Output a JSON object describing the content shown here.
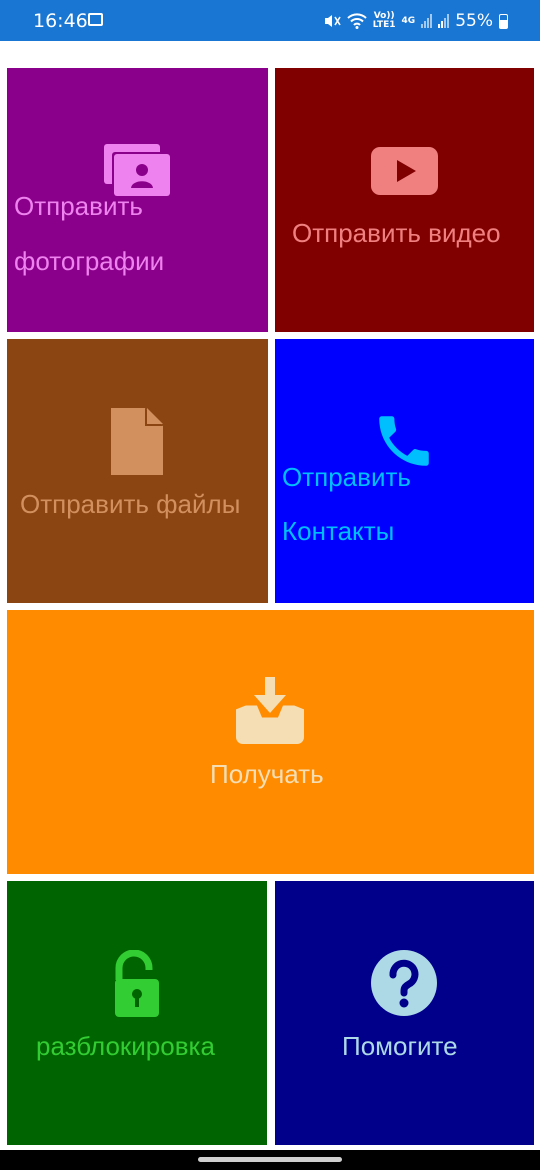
{
  "status_bar": {
    "time": "16:46",
    "network_top": "Vo))",
    "network_bottom": "LTE1",
    "gen": "4G",
    "battery": "55%"
  },
  "tiles": {
    "send_photos": {
      "line1": "Отправить",
      "line2": "фотографии",
      "icon": "photos-icon",
      "color": "#8B008B",
      "text_color": "#EE82EE"
    },
    "send_video": {
      "label": "Отправить видео",
      "icon": "play-video-icon",
      "color": "#800000",
      "text_color": "#F08080"
    },
    "send_files": {
      "label": "Отправить файлы",
      "icon": "file-icon",
      "color": "#8B4513",
      "text_color": "#D2905F"
    },
    "send_contacts": {
      "line1": "Отправить",
      "line2": "Контакты",
      "icon": "phone-icon",
      "color": "#0000FF",
      "text_color": "#00BFFF"
    },
    "receive": {
      "label": "Получать",
      "icon": "inbox-download-icon",
      "color": "#FF8C00",
      "text_color": "#F5DEB3"
    },
    "unlock": {
      "label": "разблокировка",
      "icon": "unlock-icon",
      "color": "#006400",
      "text_color": "#32CD32"
    },
    "help": {
      "label": "Помогите",
      "icon": "question-icon",
      "color": "#00008B",
      "text_color": "#ADD8E6"
    }
  }
}
